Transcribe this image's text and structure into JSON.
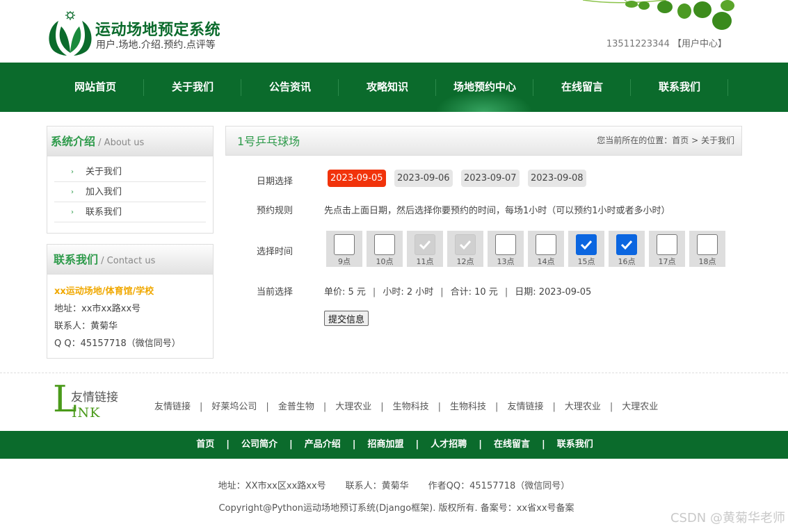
{
  "header": {
    "title": "运动场地预定系统",
    "subtitle": "用户.场地.介绍.预约.点评等",
    "phone": "13511223344",
    "user_center": "【用户中心】"
  },
  "nav": {
    "items": [
      "网站首页",
      "关于我们",
      "公告资讯",
      "攻略知识",
      "场地预约中心",
      "在线留言",
      "联系我们"
    ]
  },
  "sidebar": {
    "about": {
      "title_cn": "系统介绍",
      "title_en": "About us",
      "links": [
        "关于我们",
        "加入我们",
        "联系我们"
      ]
    },
    "contact": {
      "title_cn": "联系我们",
      "title_en": "Contact us",
      "org": "xx运动场地/体育馆/学校",
      "address": "地址：xx市xx路xx号",
      "person": "联系人：黄菊华",
      "qq": "Q Q：45157718（微信同号）"
    }
  },
  "main": {
    "title": "1号乒乓球场",
    "breadcrumb_prefix": "您当前所在的位置：",
    "breadcrumb_home": "首页",
    "breadcrumb_sep": ">",
    "breadcrumb_current": "关于我们",
    "date_label": "日期选择",
    "dates": [
      "2023-09-05",
      "2023-09-06",
      "2023-09-07",
      "2023-09-08"
    ],
    "selected_date": "2023-09-05",
    "rule_label": "预约规则",
    "rule_text": "先点击上面日期，然后选择你要预约的时间，每场1小时（可以预约1小时或者多小时）",
    "time_label": "选择时间",
    "slots": [
      {
        "label": "9点",
        "state": "empty"
      },
      {
        "label": "10点",
        "state": "empty"
      },
      {
        "label": "11点",
        "state": "disabled"
      },
      {
        "label": "12点",
        "state": "disabled"
      },
      {
        "label": "13点",
        "state": "empty"
      },
      {
        "label": "14点",
        "state": "empty"
      },
      {
        "label": "15点",
        "state": "checked"
      },
      {
        "label": "16点",
        "state": "checked"
      },
      {
        "label": "17点",
        "state": "empty"
      },
      {
        "label": "18点",
        "state": "empty"
      }
    ],
    "current_label": "当前选择",
    "summary": {
      "price": "单价: 5 元",
      "hours": "小时: 2 小时",
      "total": "合计: 10 元",
      "date": "日期: 2023-09-05"
    },
    "submit_label": "提交信息"
  },
  "links": {
    "logo_letter": "L",
    "logo_cn": "友情链接",
    "logo_ink": "INK",
    "items": [
      "友情链接",
      "好莱坞公司",
      "金普生物",
      "大理农业",
      "生物科技",
      "生物科技",
      "友情链接",
      "大理农业",
      "大理农业"
    ]
  },
  "footer": {
    "nav": [
      "首页",
      "公司简介",
      "产品介绍",
      "招商加盟",
      "人才招聘",
      "在线留言",
      "联系我们"
    ],
    "address": "地址：XX市xx区xx路xx号",
    "person": "联系人：黄菊华",
    "qq": "作者QQ：45157718（微信同号）",
    "copyright": "Copyright@Python运动场地预订系统(Django框架). 版权所有. 备案号：xx省xx号备案"
  },
  "watermark": "CSDN @黄菊华老师",
  "colors": {
    "brand_green": "#0b6b2c",
    "accent_green": "#2d9a4a",
    "active_date": "#f1330b",
    "checked_blue": "#0b66e0",
    "org_gold": "#f0a800"
  }
}
